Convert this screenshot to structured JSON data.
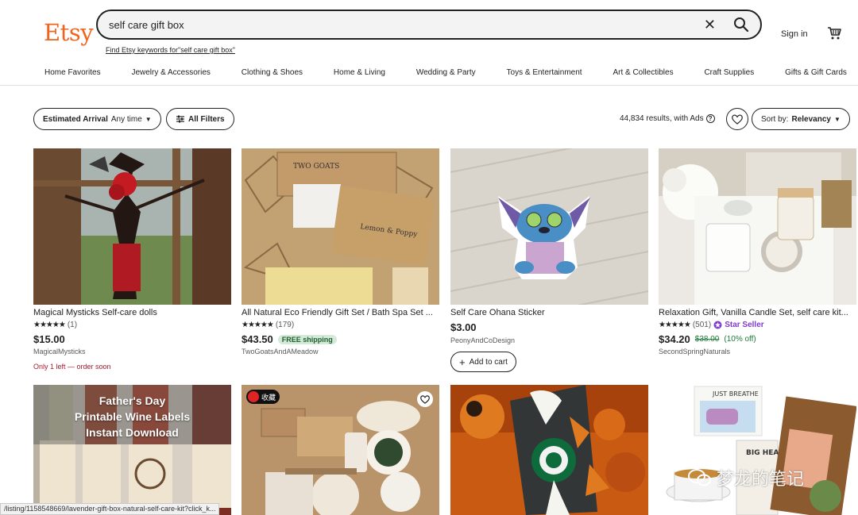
{
  "header": {
    "logo": "Etsy",
    "search_value": "self care gift box",
    "find_link": "Find Etsy keywords for\"self care gift box\"",
    "sign_in": "Sign in"
  },
  "categories": [
    "Home Favorites",
    "Jewelry & Accessories",
    "Clothing & Shoes",
    "Home & Living",
    "Wedding & Party",
    "Toys & Entertainment",
    "Art & Collectibles",
    "Craft Supplies",
    "Gifts & Gift Cards"
  ],
  "filters": {
    "estimated_label": "Estimated Arrival",
    "estimated_value": "Any time",
    "all_filters": "All Filters",
    "results": "44,834 results, with Ads",
    "sort_label": "Sort by:",
    "sort_value": "Relevancy"
  },
  "listings": [
    {
      "title": "Magical Mysticks Self-care dolls",
      "stars": "★★★★★",
      "reviews": "(1)",
      "price": "$15.00",
      "shop": "MagicalMysticks",
      "urgency": "Only 1 left — order soon"
    },
    {
      "title": "All Natural Eco Friendly Gift Set / Bath Spa Set ...",
      "stars": "★★★★★",
      "reviews": "(179)",
      "price": "$43.50",
      "free_shipping": "FREE shipping",
      "shop": "TwoGoatsAndAMeadow"
    },
    {
      "title": "Self Care Ohana Sticker",
      "price": "$3.00",
      "shop": "PeonyAndCoDesign",
      "add_to_cart": "Add to cart"
    },
    {
      "title": "Relaxation Gift, Vanilla Candle Set, self care kit...",
      "stars": "★★★★★",
      "reviews": "(501)",
      "star_seller": "Star Seller",
      "price": "$34.20",
      "original_price": "$38.00",
      "discount": "(10% off)",
      "shop": "SecondSpringNaturals"
    }
  ],
  "second_row": {
    "wine_title_lines": [
      "Father's Day",
      "Printable Wine Labels",
      "Instant Download"
    ],
    "collect_badge": "收藏",
    "card4_text_top": "JUST BREATHE",
    "card4_text_book": "BIG HEART"
  },
  "watermark": "梦龙的笔记",
  "statusbar": "/listing/1158548669/lavender-gift-box-natural-self-care-kit?click_k..."
}
